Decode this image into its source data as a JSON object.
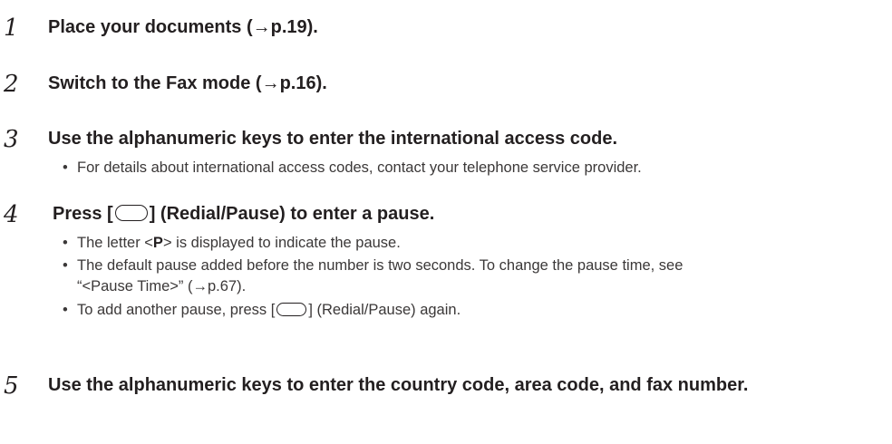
{
  "steps": [
    {
      "number": "1",
      "title": "Place your documents (→p.19).",
      "bullets": []
    },
    {
      "number": "2",
      "title": "Switch to the Fax mode (→p.16).",
      "bullets": []
    },
    {
      "number": "3",
      "title": "Use the alphanumeric keys to enter the international access code.",
      "bullets": [
        "For details about international access codes, contact your telephone service provider."
      ]
    },
    {
      "number": "4",
      "title_before": "Press [",
      "title_after": "] (Redial/Pause) to enter a pause.",
      "key_name": "redial-pause-key",
      "bullets": [
        {
          "before": "The letter <",
          "bold": "P",
          "after": "> is displayed to indicate the pause."
        },
        {
          "text": "The default pause added before the number is two seconds. To change the pause time, see “<Pause Time>” (→p.67)."
        },
        {
          "before": "To add another pause, press [",
          "after": "] (Redial/Pause) again."
        }
      ]
    },
    {
      "number": "5",
      "title": "Use the alphanumeric keys to enter the country code, area code, and fax number.",
      "bullets": []
    }
  ],
  "bullet_glyph": "•"
}
